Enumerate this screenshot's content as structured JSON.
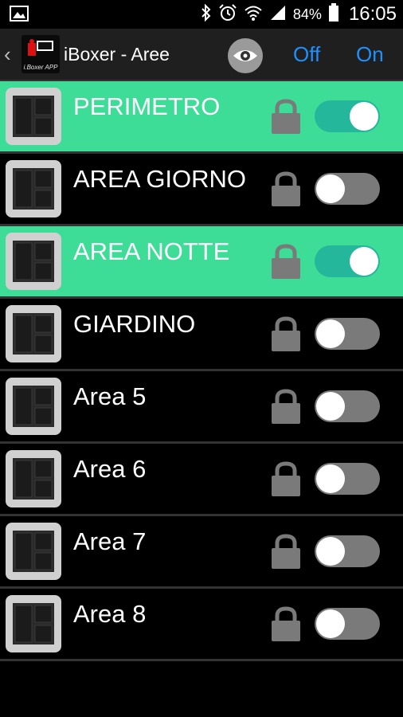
{
  "status_bar": {
    "battery": "84%",
    "time": "16:05",
    "icons": [
      "image-icon",
      "bluetooth-icon",
      "alarm-icon",
      "wifi-icon",
      "signal-icon",
      "battery-icon"
    ]
  },
  "action_bar": {
    "back_glyph": "‹",
    "logo_sub": "i.Boxer APP",
    "title": "iBoxer - Aree",
    "off_label": "Off",
    "on_label": "On"
  },
  "colors": {
    "active_row": "#3ddc97",
    "toggle_on": "#25b79c",
    "toggle_off": "#7a7a7a",
    "accent": "#1e90ff"
  },
  "areas": [
    {
      "label": "PERIMETRO",
      "enabled": true
    },
    {
      "label": "AREA GIORNO",
      "enabled": false
    },
    {
      "label": "AREA NOTTE",
      "enabled": true
    },
    {
      "label": "GIARDINO",
      "enabled": false
    },
    {
      "label": "Area 5",
      "enabled": false
    },
    {
      "label": "Area 6",
      "enabled": false
    },
    {
      "label": "Area 7",
      "enabled": false
    },
    {
      "label": "Area 8",
      "enabled": false
    }
  ]
}
